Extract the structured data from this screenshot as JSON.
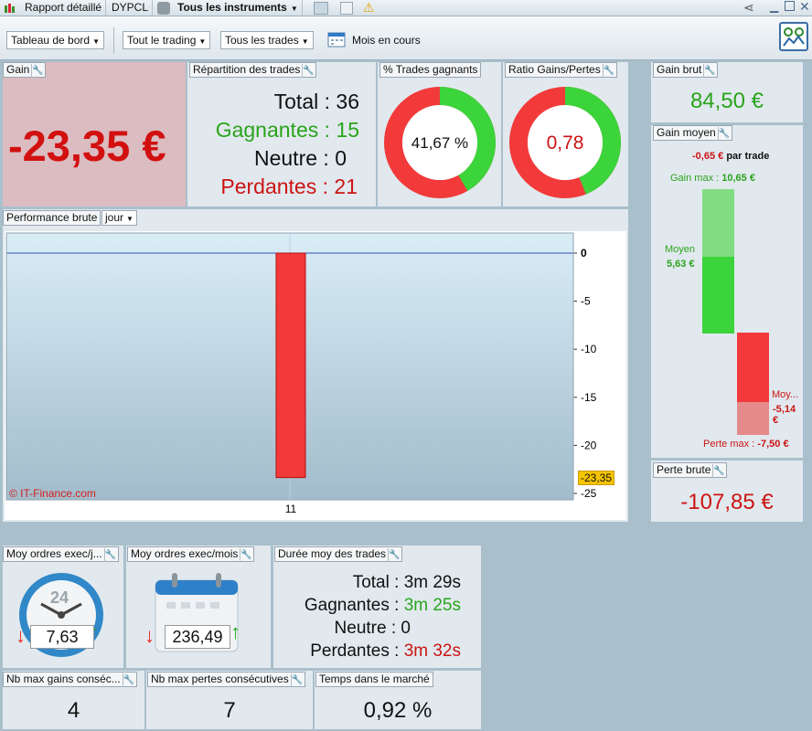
{
  "tabs": {
    "rapport": "Rapport détaillé",
    "symbol": "DYPCL",
    "instruments": "Tous les instruments"
  },
  "toolbar": {
    "view": "Tableau de bord",
    "trading": "Tout le trading",
    "trades": "Tous les trades",
    "period": "Mois en cours"
  },
  "gain": {
    "title": "Gain",
    "value": "-23,35 €"
  },
  "repartition": {
    "title": "Répartition des trades",
    "total_label": "Total",
    "total": "36",
    "win_label": "Gagnantes",
    "win": "15",
    "neutral_label": "Neutre",
    "neutral": "0",
    "loss_label": "Perdantes",
    "loss": "21"
  },
  "pct_win": {
    "title": "% Trades gagnants",
    "value": "41,67 %",
    "fraction": 0.4167
  },
  "ratio": {
    "title": "Ratio Gains/Pertes",
    "value": "0,78",
    "fraction": 0.4382
  },
  "gain_brut": {
    "title": "Gain brut",
    "value": "84,50 €"
  },
  "gain_moyen": {
    "title": "Gain moyen",
    "per_trade_value": "-0,65 €",
    "per_trade_label": "par trade",
    "gain_max_label": "Gain max :",
    "gain_max_value": "10,65 €",
    "moyen_label": "Moyen",
    "moyen_value": "5,63 €",
    "loss_moy_label": "Moy...",
    "loss_moy_value": "-5,14 €",
    "perte_max_label": "Perte max :",
    "perte_max_value": "-7,50 €"
  },
  "perte_brute": {
    "title": "Perte brute",
    "value": "-107,85 €"
  },
  "performance": {
    "title": "Performance brute",
    "period": "jour",
    "watermark": "© IT-Finance.com",
    "last_value": "-23,35"
  },
  "chart_data": {
    "type": "bar",
    "categories": [
      "11"
    ],
    "values": [
      -23.35
    ],
    "ylim": [
      -25,
      0
    ],
    "yticks": [
      0,
      -5,
      -10,
      -15,
      -20,
      -25
    ]
  },
  "exec_day": {
    "title": "Moy ordres exec/j...",
    "value": "7,63",
    "clock_label": "24"
  },
  "exec_month": {
    "title": "Moy ordres exec/mois",
    "value": "236,49"
  },
  "duree": {
    "title": "Durée moy des trades",
    "total_label": "Total",
    "total": "3m 29s",
    "win_label": "Gagnantes",
    "win": "3m 25s",
    "neutral_label": "Neutre",
    "neutral": "0",
    "loss_label": "Perdantes",
    "loss": "3m 32s"
  },
  "max_gains": {
    "title": "Nb max gains conséc...",
    "value": "4"
  },
  "max_pertes": {
    "title": "Nb max pertes consécutives",
    "value": "7"
  },
  "temps": {
    "title": "Temps dans le marché",
    "value": "0,92 %"
  },
  "colors": {
    "green": "#3bd43b",
    "red": "#f23a3a",
    "gain_bg": "#dbbcc0"
  }
}
